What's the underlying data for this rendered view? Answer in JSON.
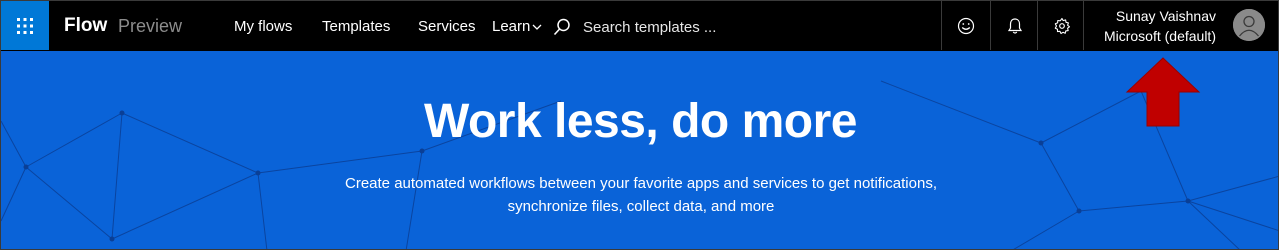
{
  "header": {
    "app_name": "Flow",
    "app_sub": "Preview",
    "nav": {
      "my_flows": "My flows",
      "templates": "Templates",
      "services": "Services",
      "learn": "Learn"
    },
    "search": {
      "placeholder": "Search templates ..."
    },
    "icons": [
      "waffle-icon",
      "search-icon",
      "smiley-icon",
      "bell-icon",
      "gear-icon",
      "chevron-down-icon",
      "avatar-icon"
    ],
    "account": {
      "name": "Sunay Vaishnav",
      "org": "Microsoft (default)"
    }
  },
  "hero": {
    "title": "Work less, do more",
    "subtitle": "Create automated workflows between your favorite apps and services to get notifications, synchronize files, collect data, and more"
  },
  "colors": {
    "topbar": "#000000",
    "waffle": "#0078d7",
    "hero": "#0a63d8",
    "arrow": "#c00000"
  }
}
